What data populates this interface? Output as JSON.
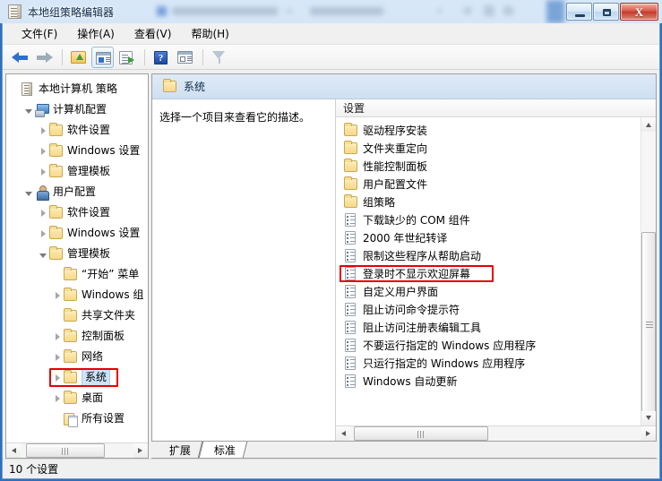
{
  "window": {
    "title": "本地组策略编辑器",
    "title_icon": "policy-editor-icon",
    "minimize_label": "",
    "maximize_label": "",
    "close_label": "X"
  },
  "menubar": {
    "items": [
      {
        "label": "文件(F)",
        "name": "menu-file"
      },
      {
        "label": "操作(A)",
        "name": "menu-action"
      },
      {
        "label": "查看(V)",
        "name": "menu-view"
      },
      {
        "label": "帮助(H)",
        "name": "menu-help"
      }
    ]
  },
  "toolbar": {
    "buttons": [
      {
        "icon": "back-arrow-icon"
      },
      {
        "icon": "forward-arrow-icon"
      },
      {
        "icon": "up-one-level-icon"
      },
      {
        "icon": "show-hide-tree-icon"
      },
      {
        "icon": "export-list-icon"
      },
      {
        "icon": "help-icon",
        "label": "?"
      },
      {
        "icon": "show-detail-pane-icon"
      },
      {
        "icon": "filter-icon"
      }
    ]
  },
  "tree": {
    "root": {
      "label": "本地计算机 策略",
      "icon": "policy-doc-icon"
    },
    "nodes": [
      {
        "label": "本地计算机 策略",
        "icon": "policy-doc-icon",
        "indent": 0,
        "glyph": "none",
        "name": "tree-item-local-computer-policy"
      },
      {
        "label": "计算机配置",
        "icon": "computer-icon",
        "indent": 1,
        "glyph": "expanded",
        "name": "tree-item-computer-configuration"
      },
      {
        "label": "软件设置",
        "icon": "folder-icon",
        "indent": 2,
        "glyph": "collapsed",
        "name": "tree-item-software-settings-computer"
      },
      {
        "label": "Windows 设置",
        "icon": "folder-icon",
        "indent": 2,
        "glyph": "collapsed",
        "name": "tree-item-windows-settings-computer"
      },
      {
        "label": "管理模板",
        "icon": "folder-icon",
        "indent": 2,
        "glyph": "collapsed",
        "name": "tree-item-admin-templates-computer"
      },
      {
        "label": "用户配置",
        "icon": "user-icon",
        "indent": 1,
        "glyph": "expanded",
        "name": "tree-item-user-configuration"
      },
      {
        "label": "软件设置",
        "icon": "folder-icon",
        "indent": 2,
        "glyph": "collapsed",
        "name": "tree-item-software-settings-user"
      },
      {
        "label": "Windows 设置",
        "icon": "folder-icon",
        "indent": 2,
        "glyph": "collapsed",
        "name": "tree-item-windows-settings-user"
      },
      {
        "label": "管理模板",
        "icon": "folder-icon",
        "indent": 2,
        "glyph": "expanded",
        "name": "tree-item-admin-templates-user"
      },
      {
        "label": "“开始” 菜单",
        "icon": "folder-icon",
        "indent": 3,
        "glyph": "none",
        "name": "tree-item-start-menu"
      },
      {
        "label": "Windows 组",
        "icon": "folder-icon",
        "indent": 3,
        "glyph": "collapsed",
        "name": "tree-item-windows-components"
      },
      {
        "label": "共享文件夹",
        "icon": "folder-icon",
        "indent": 3,
        "glyph": "none",
        "name": "tree-item-shared-folders"
      },
      {
        "label": "控制面板",
        "icon": "folder-icon",
        "indent": 3,
        "glyph": "collapsed",
        "name": "tree-item-control-panel"
      },
      {
        "label": "网络",
        "icon": "folder-icon",
        "indent": 3,
        "glyph": "collapsed",
        "name": "tree-item-network"
      },
      {
        "label": "系统",
        "icon": "folder-icon",
        "indent": 3,
        "glyph": "collapsed",
        "name": "tree-item-system",
        "selected": true,
        "highlighted": true
      },
      {
        "label": "桌面",
        "icon": "folder-icon",
        "indent": 3,
        "glyph": "collapsed",
        "name": "tree-item-desktop"
      },
      {
        "label": "所有设置",
        "icon": "all-settings-icon",
        "indent": 3,
        "glyph": "none",
        "name": "tree-item-all-settings"
      }
    ]
  },
  "right_pane": {
    "header_title": "系统",
    "header_icon": "folder-icon",
    "description": "选择一个项目来查看它的描述。",
    "column_header": "设置",
    "items": [
      {
        "label": "驱动程序安装",
        "icon": "folder-icon",
        "name": "list-item-driver-installation"
      },
      {
        "label": "文件夹重定向",
        "icon": "folder-icon",
        "name": "list-item-folder-redirection"
      },
      {
        "label": "性能控制面板",
        "icon": "folder-icon",
        "name": "list-item-performance-control-panel"
      },
      {
        "label": "用户配置文件",
        "icon": "folder-icon",
        "name": "list-item-user-profiles"
      },
      {
        "label": "组策略",
        "icon": "folder-icon",
        "name": "list-item-group-policy"
      },
      {
        "label": "下载缺少的 COM 组件",
        "icon": "policy-icon",
        "name": "list-item-download-missing-com-components"
      },
      {
        "label": "2000 年世纪转译",
        "icon": "policy-icon",
        "name": "list-item-century-interpretation"
      },
      {
        "label": "限制这些程序从帮助启动",
        "icon": "policy-icon",
        "name": "list-item-restrict-programs-from-help"
      },
      {
        "label": "登录时不显示欢迎屏幕",
        "icon": "policy-icon",
        "name": "list-item-dont-display-welcome-screen",
        "highlighted": true
      },
      {
        "label": "自定义用户界面",
        "icon": "policy-icon",
        "name": "list-item-custom-user-interface"
      },
      {
        "label": "阻止访问命令提示符",
        "icon": "policy-icon",
        "name": "list-item-prevent-access-command-prompt"
      },
      {
        "label": "阻止访问注册表编辑工具",
        "icon": "policy-icon",
        "name": "list-item-prevent-access-registry-tools"
      },
      {
        "label": "不要运行指定的 Windows 应用程序",
        "icon": "policy-icon",
        "name": "list-item-dont-run-specified-windows-apps"
      },
      {
        "label": "只运行指定的 Windows 应用程序",
        "icon": "policy-icon",
        "name": "list-item-run-only-specified-windows-apps"
      },
      {
        "label": "Windows 自动更新",
        "icon": "policy-icon",
        "name": "list-item-windows-automatic-updates"
      }
    ]
  },
  "tabs": [
    {
      "label": "扩展",
      "name": "tab-extended",
      "active": false
    },
    {
      "label": "标准",
      "name": "tab-standard",
      "active": true
    }
  ],
  "statusbar": {
    "text": "10 个设置"
  },
  "colors": {
    "highlight_red": "#e60000",
    "accent_blue": "#2f6fc0",
    "titlebar_text": "#10294a"
  }
}
